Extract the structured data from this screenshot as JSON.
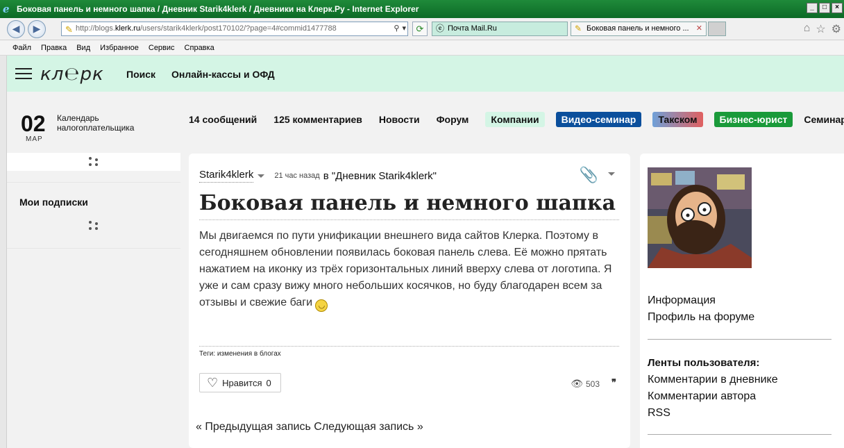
{
  "window": {
    "title": "Боковая панель и немного шапка / Дневник Starik4klerk / Дневники на Клерк.Ру - Internet Explorer",
    "ie_logo": "e"
  },
  "browser": {
    "url_prefix": "http://blogs.",
    "url_domain": "klerk.ru",
    "url_suffix": "/users/starik4klerk/post170102/?page=4#commid1477788",
    "tabs": [
      {
        "label": "Почта Mail.Ru"
      },
      {
        "label": "Боковая панель и немного ..."
      }
    ]
  },
  "menu": [
    "Файл",
    "Правка",
    "Вид",
    "Избранное",
    "Сервис",
    "Справка"
  ],
  "site": {
    "logo": "кл℮рк",
    "header_links": [
      "Поиск",
      "Онлайн-кассы и ОФД"
    ],
    "calendar": {
      "day": "02",
      "month": "МАР",
      "label": "Календарь налогоплательщика"
    },
    "subscriptions_title": "Мои подписки",
    "nav": {
      "plain": [
        "14 сообщений",
        "125 комментариев",
        "Новости",
        "Форум"
      ],
      "pills": [
        {
          "label": "Компании",
          "bg": "#d4f5e5",
          "color": "#111111"
        },
        {
          "label": "Видео-семинар",
          "bg": "#0b4f9c",
          "color": "#ffffff"
        },
        {
          "label": "Такском",
          "bg": "linear-gradient(90deg,#6fa0d8,#e06060)",
          "color": "#111111"
        },
        {
          "label": "Бизнес-юрист",
          "bg": "#1a9a3a",
          "color": "#ffffff"
        }
      ],
      "last": "Семинары"
    }
  },
  "post": {
    "author": "Starik4klerk",
    "ago": "21 час назад",
    "in_blog": "в \"Дневник Starik4klerk\"",
    "title": "Боковая панель и немного шапка",
    "body": "Мы двигаемся по пути унификации внешнего вида сайтов Клерка. Поэтому в сегодняшнем обновлении появилась боковая панель слева. Её можно прятать нажатием на иконку из трёх горизонтальных линий вверху слева от логотипа. Я уже и сам сразу вижу много небольших косячков, но буду благодарен всем за отзывы и свежие баги",
    "tags": "Теги: изменения в блогах",
    "like_label": "Нравится",
    "like_count": "0",
    "views": "503",
    "prev": "« Предыдущая запись",
    "next": "Следующая запись »"
  },
  "sidebar": {
    "links": [
      "Информация",
      "Профиль на форуме"
    ],
    "feeds_title": "Ленты пользователя:",
    "feeds": [
      "Комментарии в дневнике",
      "Комментарии автора",
      "RSS"
    ]
  }
}
